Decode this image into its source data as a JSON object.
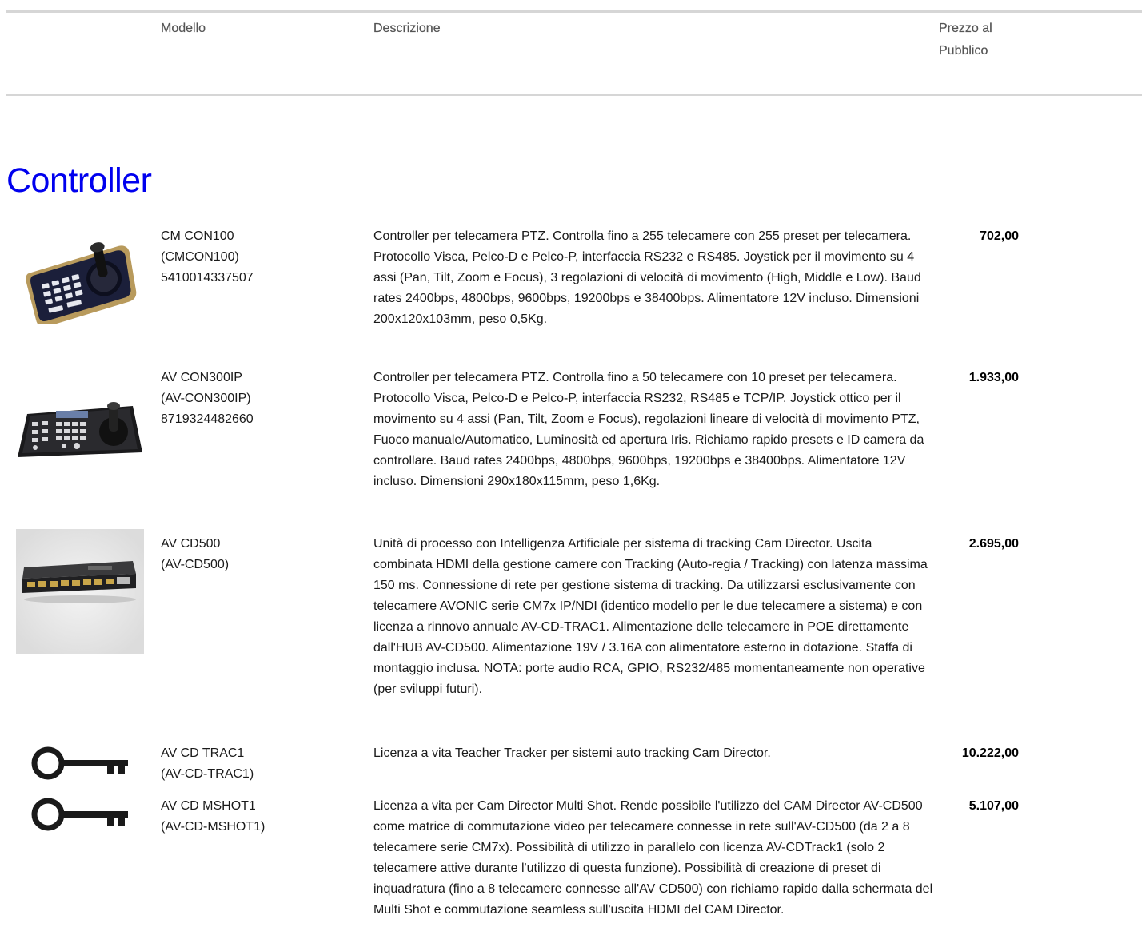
{
  "table_header": {
    "model": "Modello",
    "description": "Descrizione",
    "price_line1": "Prezzo al",
    "price_line2": "Pubblico"
  },
  "section": {
    "title": "Controller"
  },
  "products": [
    {
      "name": "CM CON100",
      "code": "(CMCON100)",
      "ean": "5410014337507",
      "image_icon": "ptz-joystick-controller-photo",
      "description": "Controller per telecamera PTZ. Controlla fino a 255 telecamere con 255 preset per telecamera. Protocollo Visca, Pelco-D e Pelco-P, interfaccia RS232 e RS485. Joystick per il movimento su 4 assi (Pan, Tilt, Zoom e Focus), 3 regolazioni di velocità di movimento (High, Middle e Low). Baud rates 2400bps, 4800bps, 9600bps, 19200bps e 38400bps. Alimentatore 12V incluso. Dimensioni 200x120x103mm, peso 0,5Kg.",
      "price": "702,00"
    },
    {
      "name": "AV CON300IP",
      "code": "(AV-CON300IP)",
      "ean": "8719324482660",
      "image_icon": "ip-ptz-controller-photo",
      "description": "Controller per telecamera PTZ. Controlla fino a 50 telecamere con 10 preset per telecamera. Protocollo Visca, Pelco-D e Pelco-P, interfaccia RS232, RS485 e TCP/IP. Joystick ottico per il movimento su 4 assi (Pan, Tilt, Zoom e Focus), regolazioni lineare di velocità di movimento PTZ, Fuoco manuale/Automatico, Luminosità ed apertura Iris. Richiamo rapido presets e ID camera da controllare. Baud rates 2400bps, 4800bps, 9600bps, 19200bps e 38400bps. Alimentatore 12V incluso. Dimensioni 290x180x115mm, peso 1,6Kg.",
      "price": "1.933,00"
    },
    {
      "name": "AV CD500",
      "code": "(AV-CD500)",
      "ean": "",
      "image_icon": "poe-hub-processor-photo",
      "description": "Unità di processo con Intelligenza Artificiale per sistema di tracking Cam Director. Uscita combinata HDMI della gestione camere con Tracking (Auto-regia / Tracking) con latenza massima 150 ms. Connessione di rete per gestione sistema di tracking. Da utilizzarsi esclusivamente con telecamere AVONIC serie CM7x IP/NDI (identico modello per le due telecamere a sistema) e con licenza a rinnovo annuale AV-CD-TRAC1. Alimentazione delle telecamere in POE direttamente dall'HUB AV-CD500. Alimentazione 19V / 3.16A con alimentatore esterno in dotazione. Staffa di montaggio inclusa. NOTA: porte audio RCA, GPIO, RS232/485 momentaneamente non operative (per sviluppi futuri).",
      "price": "2.695,00"
    },
    {
      "name": "AV CD TRAC1",
      "code": "(AV-CD-TRAC1)",
      "ean": "",
      "image_icon": "license-key-icon",
      "description": "Licenza a vita Teacher Tracker per sistemi auto tracking Cam Director.",
      "price": "10.222,00"
    },
    {
      "name": "AV CD MSHOT1",
      "code": "(AV-CD-MSHOT1)",
      "ean": "",
      "image_icon": "license-key-icon",
      "description": "Licenza a vita per Cam Director Multi Shot. Rende possibile l'utilizzo del CAM Director AV-CD500 come matrice di commutazione video per telecamere connesse in rete sull'AV-CD500 (da 2 a 8 telecamere serie CM7x). Possibilità di utilizzo in parallelo con licenza AV-CDTrack1 (solo 2 telecamere attive durante l'utilizzo di questa funzione). Possibilità di creazione di preset di inquadratura (fino a 8 telecamere connesse all'AV CD500) con richiamo rapido dalla schermata del Multi Shot e commutazione seamless sull'uscita HDMI del CAM Director.",
      "price": "5.107,00"
    }
  ]
}
